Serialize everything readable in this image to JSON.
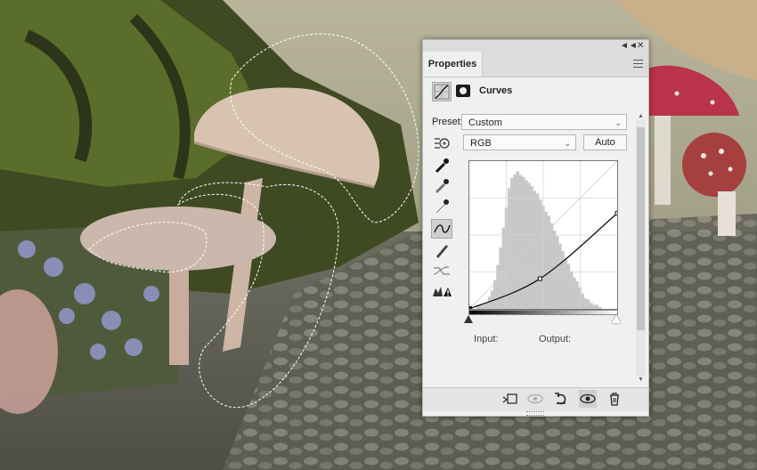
{
  "panel": {
    "tab_label": "Properties",
    "header_label": "Curves",
    "preset_label": "Preset:",
    "preset_value": "Custom",
    "channel_value": "RGB",
    "auto_label": "Auto",
    "input_label": "Input:",
    "output_label": "Output:"
  },
  "icons": {
    "collapse": "double-chevron-icon",
    "close": "close-icon",
    "menu": "panel-menu-icon",
    "adjustment": "curves-adjustment-icon",
    "mask": "layer-mask-icon",
    "tools": [
      "on-image-adjust-icon",
      "sample-black-eyedropper-icon",
      "sample-gray-eyedropper-icon",
      "sample-white-eyedropper-icon",
      "edit-points-icon",
      "draw-pencil-icon",
      "smooth-curve-icon",
      "clipping-warning-icon"
    ],
    "bottom": [
      "clip-to-layer-icon",
      "view-previous-icon",
      "reset-icon",
      "visibility-eye-icon",
      "delete-trash-icon"
    ]
  },
  "colors": {
    "panel_bg": "#f0f0f0",
    "histogram": "#c8c8c8",
    "curve": "#111111"
  },
  "chart_data": {
    "type": "area",
    "xlim": [
      0,
      255
    ],
    "ylim": [
      0,
      255
    ],
    "histogram": [
      2,
      3,
      4,
      6,
      9,
      14,
      22,
      32,
      45,
      60,
      75,
      88,
      96,
      99,
      100,
      98,
      97,
      95,
      92,
      90,
      87,
      84,
      80,
      76,
      72,
      68,
      63,
      58,
      53,
      48,
      43,
      38,
      33,
      28,
      24,
      20,
      16,
      12,
      9,
      7,
      5,
      4,
      3,
      2,
      1,
      1
    ],
    "curve_points": [
      [
        0,
        0
      ],
      [
        122,
        52
      ],
      [
        255,
        165
      ]
    ]
  }
}
